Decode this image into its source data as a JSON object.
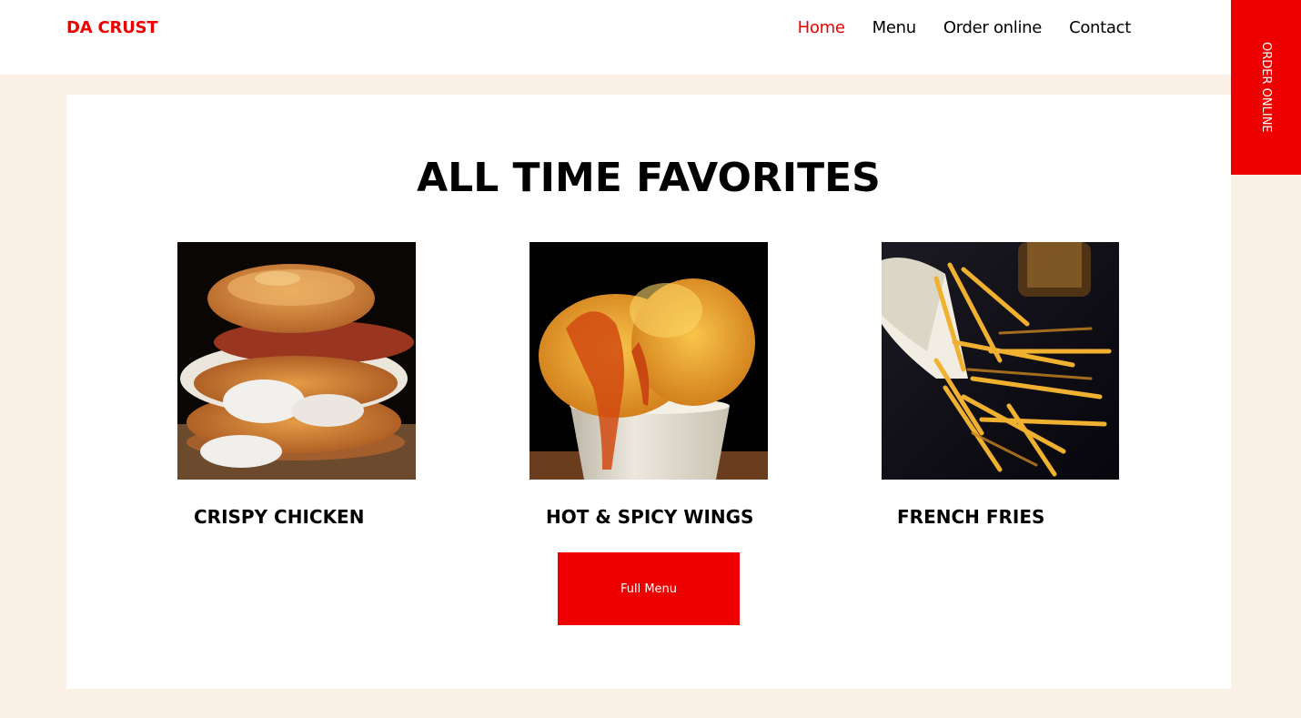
{
  "header": {
    "brand": "DA CRUST",
    "nav": [
      {
        "label": "Home",
        "active": true
      },
      {
        "label": "Menu",
        "active": false
      },
      {
        "label": "Order online",
        "active": false
      },
      {
        "label": "Contact",
        "active": false
      }
    ]
  },
  "side_tab": {
    "label": "ORDER ONLINE"
  },
  "section": {
    "title": "ALL TIME FAVORITES",
    "items": [
      {
        "name": "CRISPY CHICKEN",
        "image": "crispy-chicken-sandwich-photo"
      },
      {
        "name": "HOT & SPICY WINGS",
        "image": "spicy-wings-bucket-photo"
      },
      {
        "name": "FRENCH FRIES",
        "image": "french-fries-photo"
      }
    ],
    "cta_label": "Full Menu"
  },
  "colors": {
    "accent": "#ee0000",
    "page_background": "#faf0e6",
    "panel_background": "#ffffff",
    "text": "#000000"
  }
}
